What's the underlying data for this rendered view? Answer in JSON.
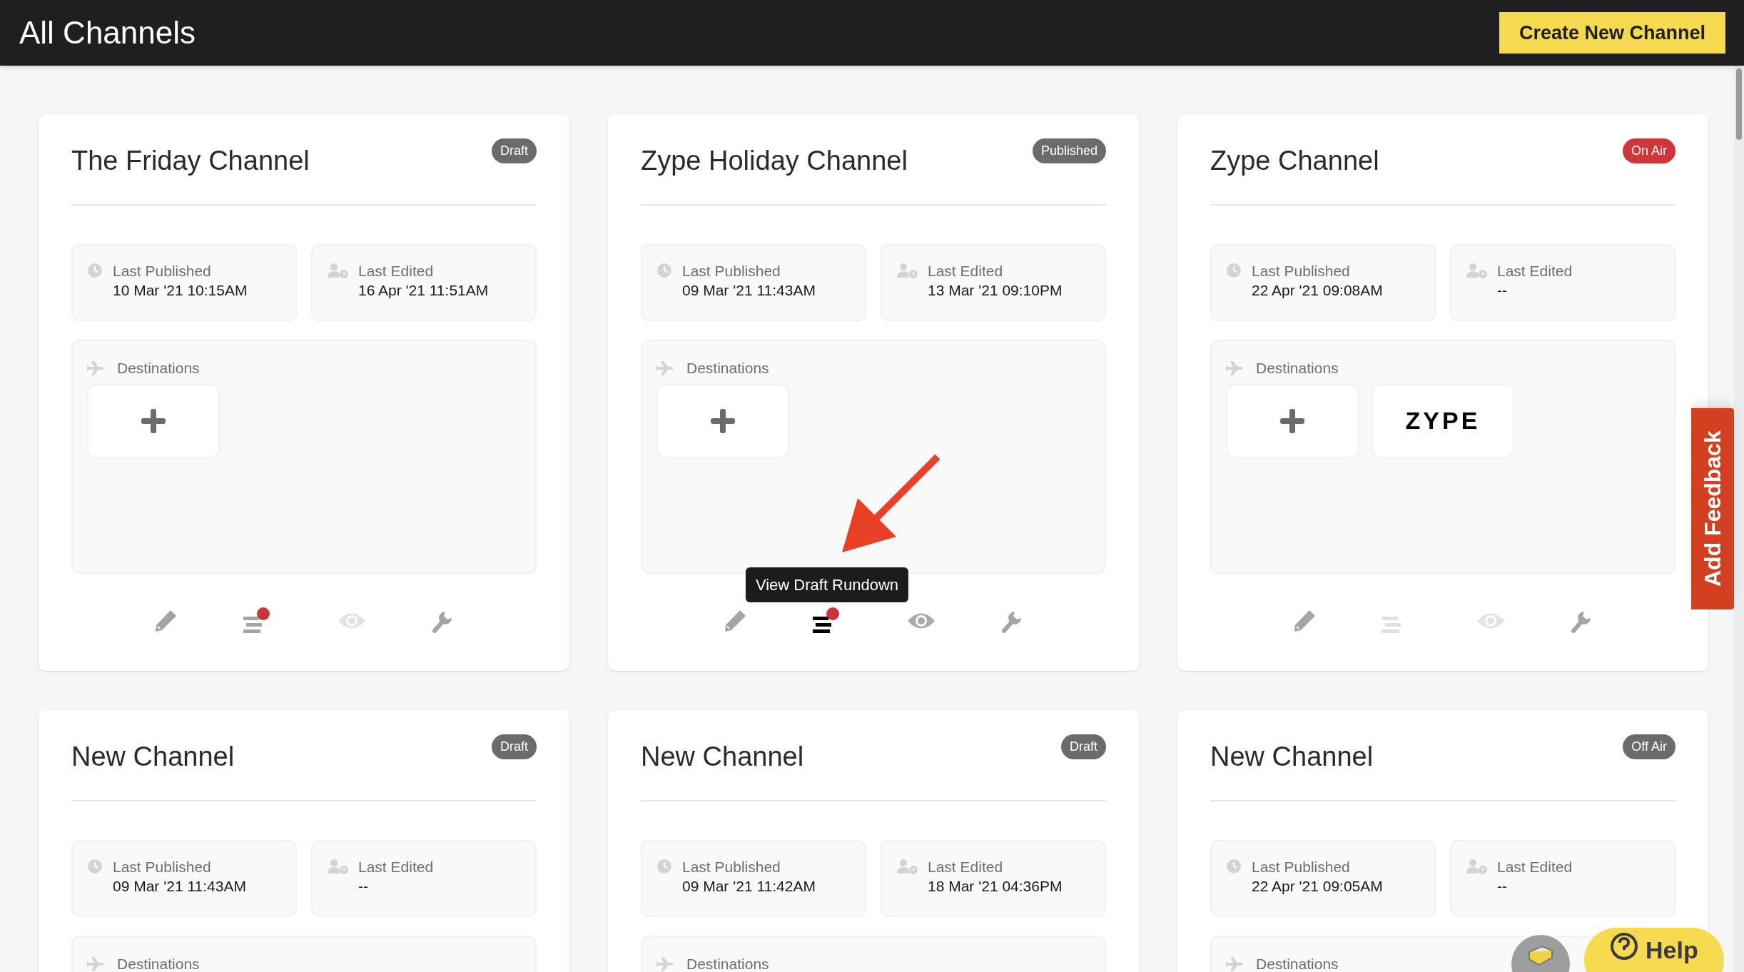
{
  "header": {
    "title": "All Channels",
    "create_button": "Create New Channel"
  },
  "channels": [
    {
      "title": "The Friday Channel",
      "status": {
        "label": "Draft",
        "color": "#6b6b6b"
      },
      "published_label": "Last Published",
      "published": "10 Mar '21 10:15AM",
      "edited_label": "Last Edited",
      "edited": "16 Apr '21 11:51AM",
      "destinations_label": "Destinations",
      "destinations": [
        {
          "kind": "add"
        }
      ],
      "actions": {
        "rundown_badge": true,
        "rundown_enabled": true,
        "rundown_highlighted": false,
        "preview_enabled": false
      }
    },
    {
      "title": "Zype Holiday Channel",
      "status": {
        "label": "Published",
        "color": "#6b6b6b"
      },
      "published_label": "Last Published",
      "published": "09 Mar '21 11:43AM",
      "edited_label": "Last Edited",
      "edited": "13 Mar '21 09:10PM",
      "destinations_label": "Destinations",
      "destinations": [
        {
          "kind": "add"
        }
      ],
      "actions": {
        "rundown_badge": true,
        "rundown_enabled": true,
        "rundown_highlighted": true,
        "preview_enabled": true,
        "tooltip": "View Draft Rundown"
      }
    },
    {
      "title": "Zype Channel",
      "status": {
        "label": "On Air",
        "color": "#d0353a"
      },
      "published_label": "Last Published",
      "published": "22 Apr '21 09:08AM",
      "edited_label": "Last Edited",
      "edited": "--",
      "destinations_label": "Destinations",
      "destinations": [
        {
          "kind": "add"
        },
        {
          "kind": "logo",
          "label": "ZYPE"
        }
      ],
      "actions": {
        "rundown_badge": false,
        "rundown_enabled": false,
        "rundown_highlighted": false,
        "preview_enabled": false
      }
    },
    {
      "title": "New Channel",
      "status": {
        "label": "Draft",
        "color": "#6b6b6b"
      },
      "published_label": "Last Published",
      "published": "09 Mar '21 11:43AM",
      "edited_label": "Last Edited",
      "edited": "--",
      "destinations_label": "Destinations"
    },
    {
      "title": "New Channel",
      "status": {
        "label": "Draft",
        "color": "#6b6b6b"
      },
      "published_label": "Last Published",
      "published": "09 Mar '21 11:42AM",
      "edited_label": "Last Edited",
      "edited": "18 Mar '21 04:36PM",
      "destinations_label": "Destinations"
    },
    {
      "title": "New Channel",
      "status": {
        "label": "Off Air",
        "color": "#6b6b6b"
      },
      "published_label": "Last Published",
      "published": "22 Apr '21 09:05AM",
      "edited_label": "Last Edited",
      "edited": "--",
      "destinations_label": "Destinations"
    }
  ],
  "feedback_tab": "Add Feedback",
  "help_button": "Help"
}
